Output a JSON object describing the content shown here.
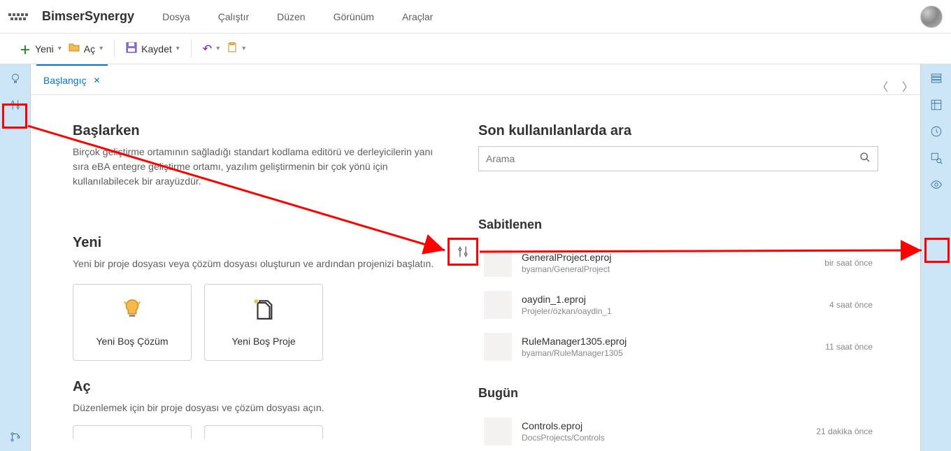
{
  "brand": "BimserSynergy",
  "menus": {
    "file": "Dosya",
    "run": "Çalıştır",
    "edit": "Düzen",
    "view": "Görünüm",
    "tools": "Araçlar"
  },
  "commands": {
    "new": "Yeni",
    "open": "Aç",
    "save": "Kaydet"
  },
  "tab": {
    "label": "Başlangıç"
  },
  "start": {
    "title": "Başlarken",
    "desc": "Birçok geliştirme ortamının sağladığı standart kodlama editörü ve derleyicilerin yanı sıra eBA entegre geliştirme ortamı, yazılım geliştirmenin bir çok yönü için kullanılabilecek bir arayüzdür."
  },
  "newSection": {
    "title": "Yeni",
    "desc": "Yeni bir proje dosyası veya çözüm dosyası oluşturun ve ardından projenizi başlatın.",
    "tile_solution": "Yeni Boş Çözüm",
    "tile_project": "Yeni Boş Proje"
  },
  "openSection": {
    "title": "Aç",
    "desc": "Düzenlemek için bir proje dosyası ve çözüm dosyası açın."
  },
  "recent": {
    "title": "Son kullanılanlarda ara",
    "placeholder": "Arama",
    "pinned_title": "Sabitlenen",
    "today_title": "Bugün",
    "pinned": [
      {
        "name": "GeneralProject.eproj",
        "path": "byaman/GeneralProject",
        "time": "bir saat önce"
      },
      {
        "name": "oaydin_1.eproj",
        "path": "Projeler/özkan/oaydin_1",
        "time": "4 saat önce"
      },
      {
        "name": "RuleManager1305.eproj",
        "path": "byaman/RuleManager1305",
        "time": "11 saat önce"
      }
    ],
    "today": [
      {
        "name": "Controls.eproj",
        "path": "DocsProjects/Controls",
        "time": "21 dakika önce"
      }
    ]
  }
}
